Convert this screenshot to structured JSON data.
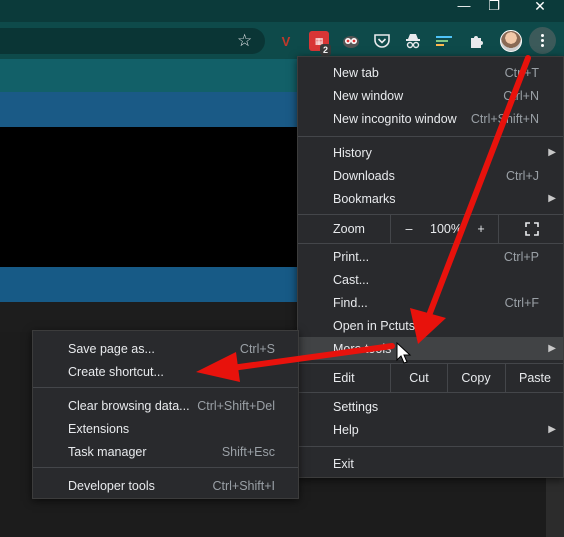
{
  "window": {
    "minimize": "—",
    "restore": "❐",
    "close": "✕"
  },
  "toolbar": {
    "extension_badge": "2",
    "icons": [
      "bookmark-star-icon",
      "vivaldi-extension-icon",
      "todo-extension-icon",
      "owl-extension-icon",
      "pocket-icon",
      "incognito-spy-icon",
      "network-extension-icon",
      "puzzle-extensions-icon"
    ]
  },
  "main_menu": {
    "group1": [
      {
        "label": "New tab",
        "shortcut": "Ctrl+T"
      },
      {
        "label": "New window",
        "shortcut": "Ctrl+N"
      },
      {
        "label": "New incognito window",
        "shortcut": "Ctrl+Shift+N"
      }
    ],
    "group2": [
      {
        "label": "History",
        "shortcut": ""
      },
      {
        "label": "Downloads",
        "shortcut": "Ctrl+J"
      },
      {
        "label": "Bookmarks",
        "shortcut": ""
      }
    ],
    "zoom": {
      "label": "Zoom",
      "minus": "–",
      "value": "100%",
      "plus": "+"
    },
    "group3": [
      {
        "label": "Print...",
        "shortcut": "Ctrl+P"
      },
      {
        "label": "Cast...",
        "shortcut": ""
      },
      {
        "label": "Find...",
        "shortcut": "Ctrl+F"
      },
      {
        "label": "Open in Pctuts.be",
        "shortcut": ""
      },
      {
        "label": "More tools",
        "shortcut": ""
      }
    ],
    "edit": {
      "label": "Edit",
      "cut": "Cut",
      "copy": "Copy",
      "paste": "Paste"
    },
    "group4": [
      {
        "label": "Settings",
        "shortcut": ""
      },
      {
        "label": "Help",
        "shortcut": ""
      }
    ],
    "exit": "Exit"
  },
  "more_tools_menu": {
    "group1": [
      {
        "label": "Save page as...",
        "shortcut": "Ctrl+S"
      },
      {
        "label": "Create shortcut...",
        "shortcut": ""
      }
    ],
    "group2": [
      {
        "label": "Clear browsing data...",
        "shortcut": "Ctrl+Shift+Del"
      },
      {
        "label": "Extensions",
        "shortcut": ""
      },
      {
        "label": "Task manager",
        "shortcut": "Shift+Esc"
      }
    ],
    "group3": [
      {
        "label": "Developer tools",
        "shortcut": "Ctrl+Shift+I"
      }
    ]
  },
  "colors": {
    "annotation_arrow": "#e8120c",
    "menu_bg": "#292a2d",
    "highlight": "#414345"
  }
}
